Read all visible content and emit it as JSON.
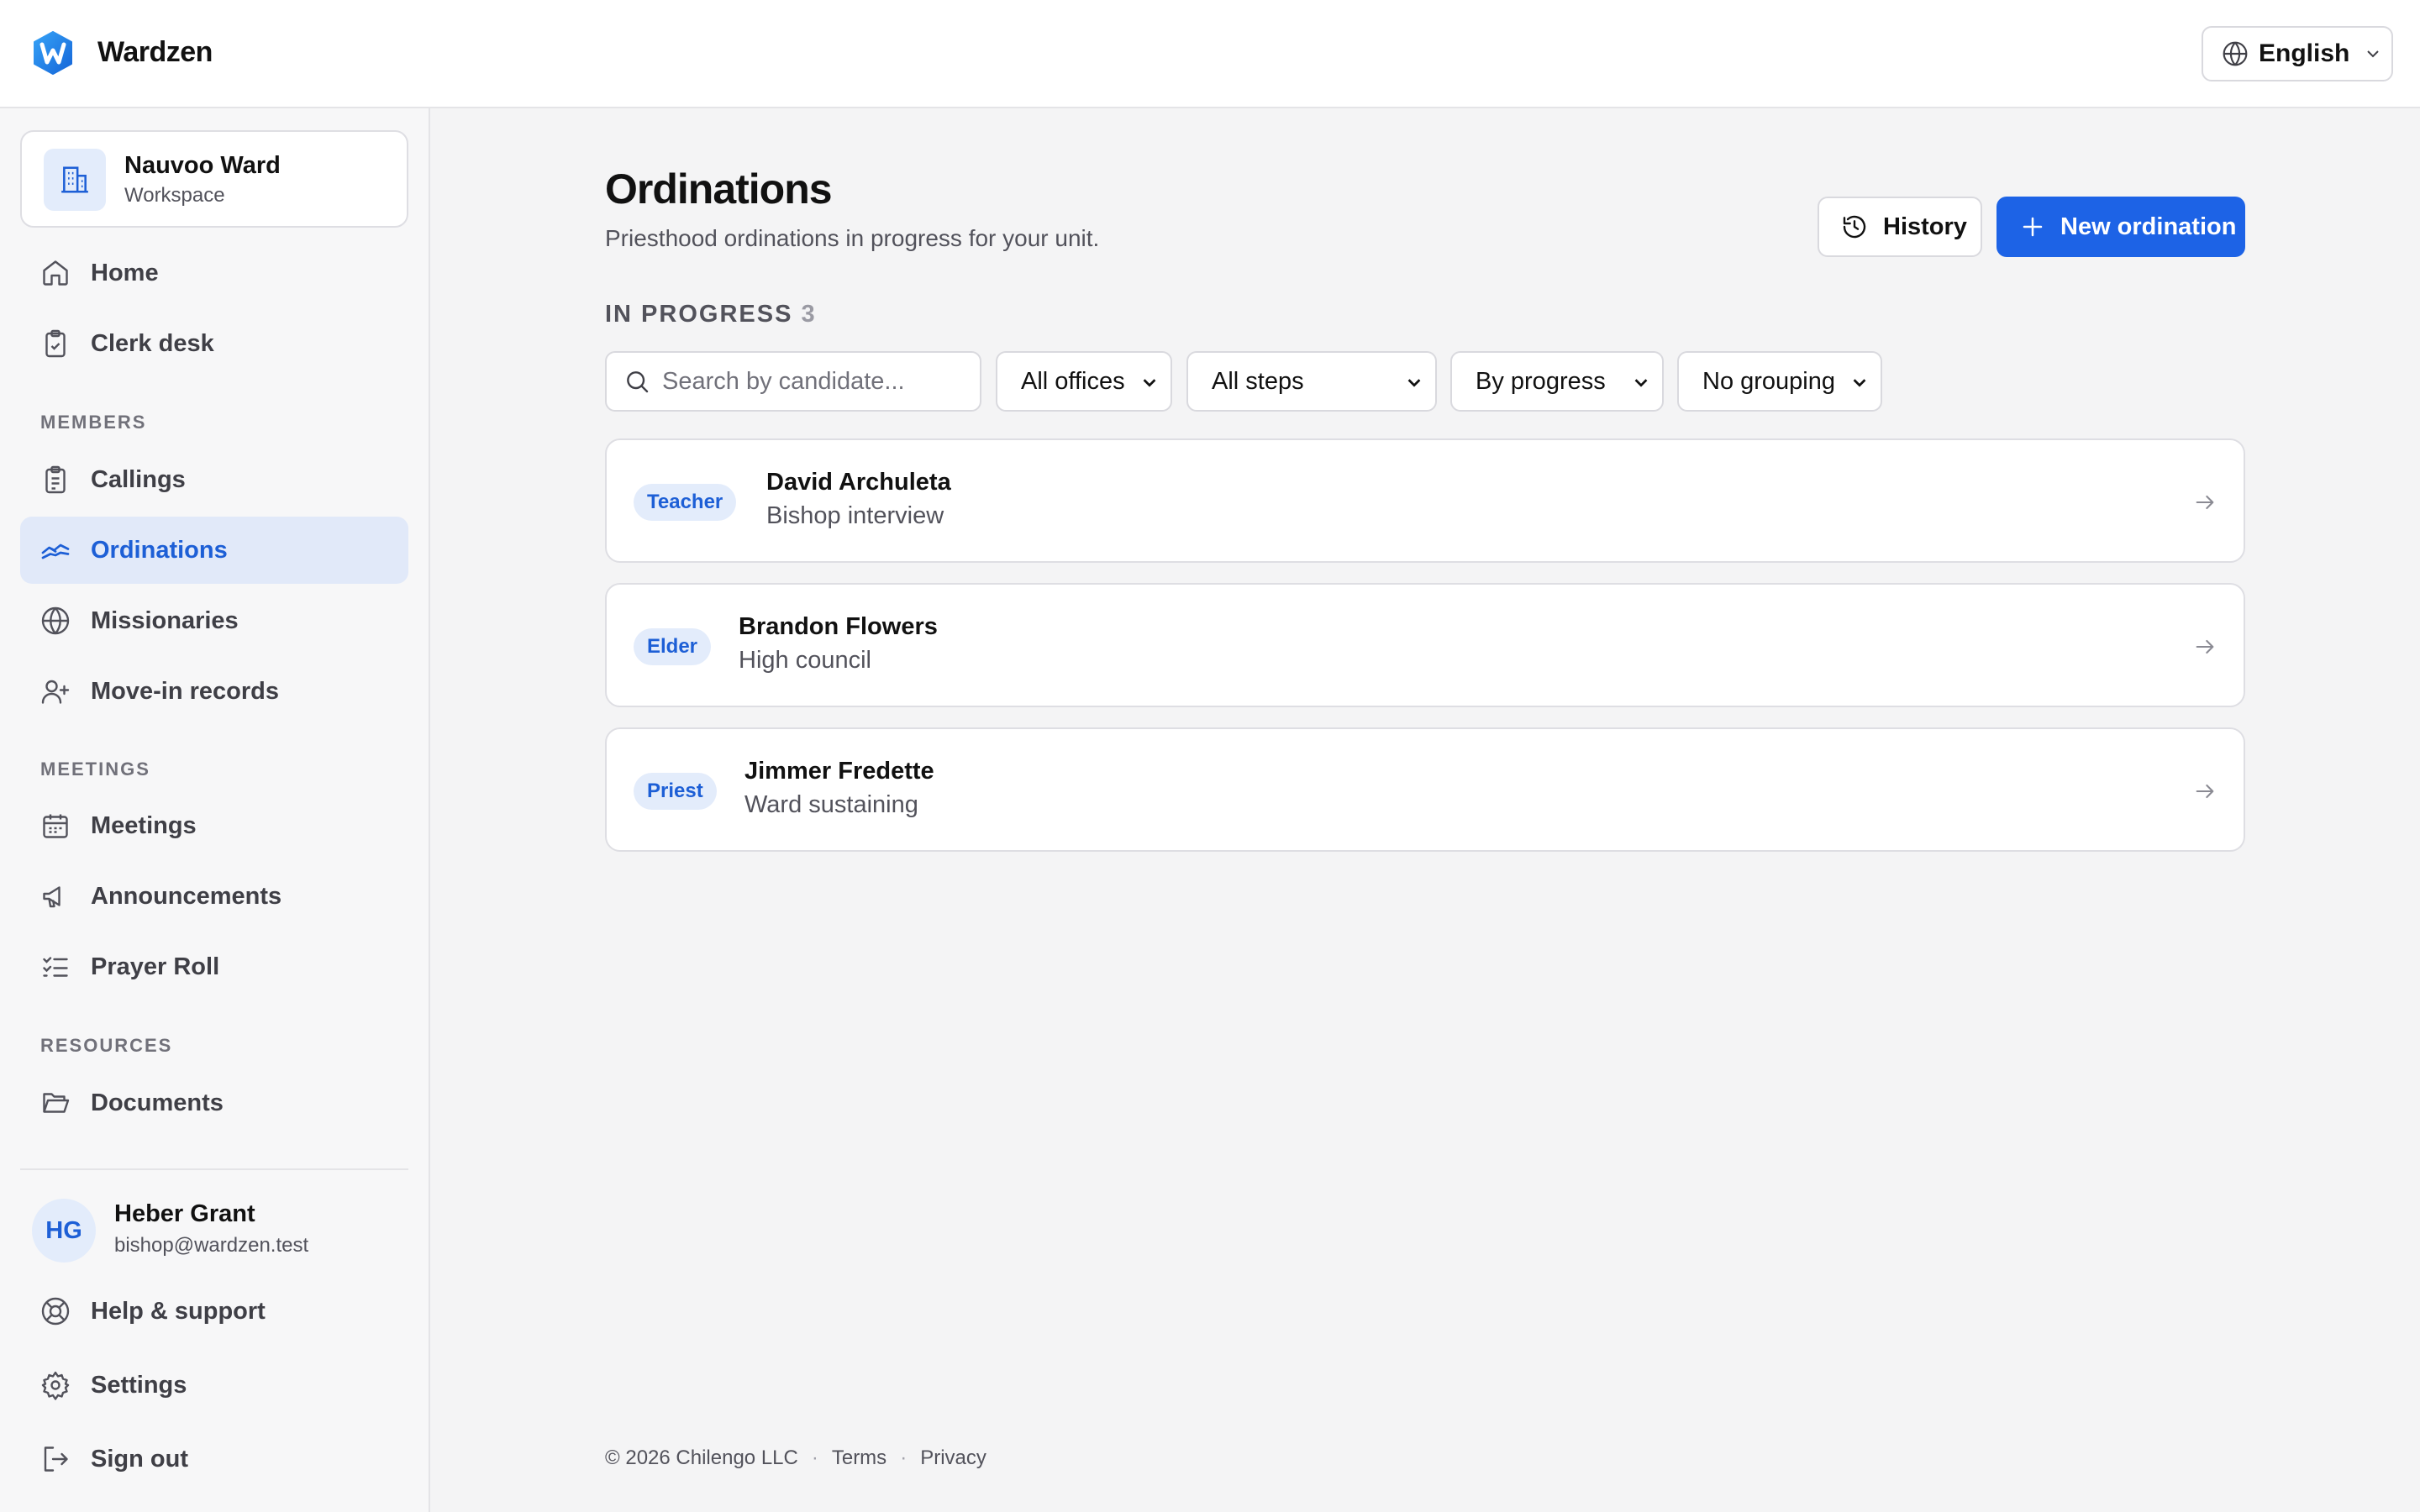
{
  "app": {
    "name": "Wardzen",
    "language": "English"
  },
  "workspace": {
    "name": "Nauvoo Ward",
    "subtitle": "Workspace"
  },
  "sidebar": {
    "top_items": [
      {
        "label": "Home",
        "icon": "home-icon"
      },
      {
        "label": "Clerk desk",
        "icon": "clipboard-check-icon"
      }
    ],
    "sections": [
      {
        "label": "MEMBERS",
        "items": [
          {
            "label": "Callings",
            "icon": "clipboard-list-icon"
          },
          {
            "label": "Ordinations",
            "icon": "hands-icon",
            "active": true
          },
          {
            "label": "Missionaries",
            "icon": "globe-icon"
          },
          {
            "label": "Move-in records",
            "icon": "user-plus-icon"
          }
        ]
      },
      {
        "label": "MEETINGS",
        "items": [
          {
            "label": "Meetings",
            "icon": "calendar-icon"
          },
          {
            "label": "Announcements",
            "icon": "megaphone-icon"
          },
          {
            "label": "Prayer Roll",
            "icon": "list-checks-icon"
          }
        ]
      },
      {
        "label": "RESOURCES",
        "items": [
          {
            "label": "Documents",
            "icon": "folder-open-icon"
          }
        ]
      }
    ],
    "user": {
      "initials": "HG",
      "name": "Heber Grant",
      "email": "bishop@wardzen.test"
    },
    "bottom_items": [
      {
        "label": "Help & support",
        "icon": "lifebuoy-icon"
      },
      {
        "label": "Settings",
        "icon": "gear-icon"
      },
      {
        "label": "Sign out",
        "icon": "sign-out-icon"
      }
    ]
  },
  "page": {
    "title": "Ordinations",
    "subtitle": "Priesthood ordinations in progress for your unit.",
    "history_label": "History",
    "new_label": "New ordination",
    "section_label": "IN PROGRESS",
    "count": "3"
  },
  "filters": {
    "search_placeholder": "Search by candidate...",
    "office": "All offices",
    "step": "All steps",
    "sort": "By progress",
    "grouping": "No grouping"
  },
  "ordinations": [
    {
      "office": "Teacher",
      "name": "David Archuleta",
      "step": "Bishop interview"
    },
    {
      "office": "Elder",
      "name": "Brandon Flowers",
      "step": "High council"
    },
    {
      "office": "Priest",
      "name": "Jimmer Fredette",
      "step": "Ward sustaining"
    }
  ],
  "footer": {
    "copyright": "© 2026 Chilengo LLC",
    "terms": "Terms",
    "privacy": "Privacy"
  },
  "colors": {
    "accent": "#1d63e6",
    "active_bg": "#e1e9f9",
    "badge_bg": "#e3ecfb",
    "logo_blue": "#1e88e5"
  }
}
